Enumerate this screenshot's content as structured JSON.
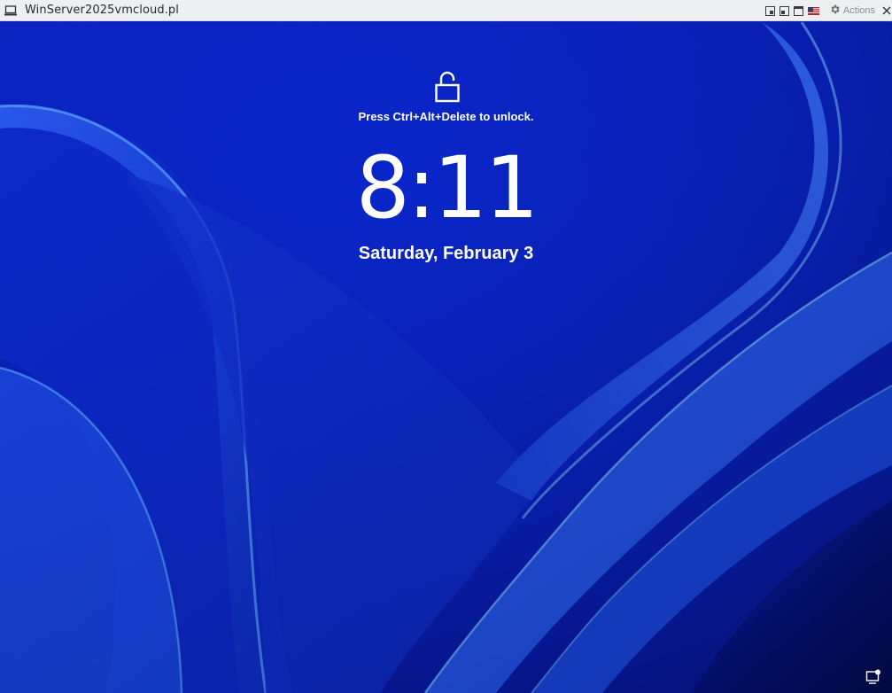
{
  "window": {
    "title": "WinServer2025vmcloud.pl",
    "actions_label": "Actions"
  },
  "lockscreen": {
    "hint": "Press Ctrl+Alt+Delete to unlock.",
    "time": "8:11",
    "date": "Saturday, February 3"
  },
  "colors": {
    "background": "#0a1fb8",
    "text": "#ffffff",
    "titlebar": "#eeeff1"
  },
  "icons": {
    "window": "computer-icon",
    "lock": "unlock-icon",
    "network": "network-icon",
    "settings": "gear-icon"
  }
}
